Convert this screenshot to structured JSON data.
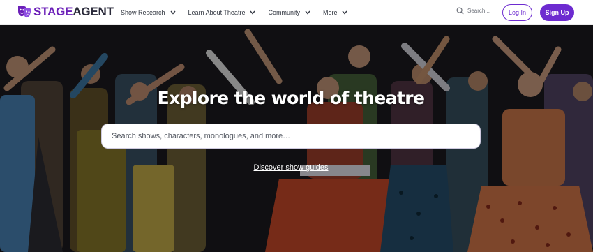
{
  "brand": {
    "name_part1": "STAGE",
    "name_part2": "AGENT",
    "logo_icon": "theatre-masks-icon",
    "accent_color": "#6d2bd0"
  },
  "nav": {
    "menu": [
      {
        "label": "Show Research",
        "icon": "chevron-down-icon"
      },
      {
        "label": "Learn About Theatre",
        "icon": "chevron-down-icon"
      },
      {
        "label": "Community",
        "icon": "chevron-down-icon"
      },
      {
        "label": "More",
        "icon": "chevron-down-icon"
      }
    ],
    "search_placeholder": "Search...",
    "search_icon": "search-icon",
    "login_label": "Log In",
    "signup_label": "Sign Up"
  },
  "hero": {
    "title": "Explore the world of theatre",
    "search_placeholder": "Search shows, characters, monologues, and more…",
    "link_label": "Discover show guides"
  }
}
